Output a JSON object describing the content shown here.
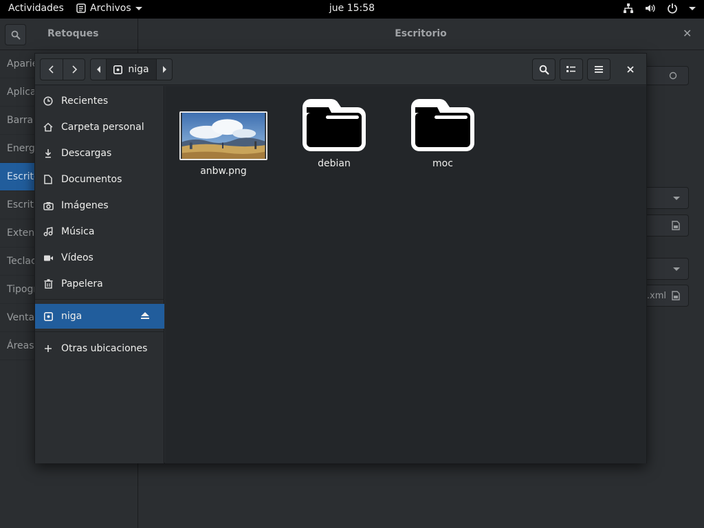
{
  "topbar": {
    "activities": "Actividades",
    "app_name": "Archivos",
    "clock": "jue 15:58"
  },
  "tweaks": {
    "left_title": "Retoques",
    "center_title": "Escritorio",
    "sidebar": [
      "Aparie",
      "Aplica",
      "Barra s",
      "Energí",
      "Escrito",
      "Escritu",
      "Extens",
      "Teclac",
      "Tipogr",
      "Ventan",
      "Áreas"
    ],
    "selected_index": 4,
    "field_suffix": ".xml"
  },
  "dialog": {
    "path_label": "niga",
    "places": [
      {
        "label": "Recientes",
        "icon": "clock-icon"
      },
      {
        "label": "Carpeta personal",
        "icon": "home-icon"
      },
      {
        "label": "Descargas",
        "icon": "download-icon"
      },
      {
        "label": "Documentos",
        "icon": "document-icon"
      },
      {
        "label": "Imágenes",
        "icon": "camera-icon"
      },
      {
        "label": "Música",
        "icon": "music-icon"
      },
      {
        "label": "Vídeos",
        "icon": "video-icon"
      },
      {
        "label": "Papelera",
        "icon": "trash-icon"
      }
    ],
    "mounted": {
      "label": "niga",
      "icon": "drive-icon"
    },
    "other": {
      "label": "Otras ubicaciones",
      "icon": "plus-icon"
    },
    "files": [
      {
        "name": "anbw.png",
        "kind": "image"
      },
      {
        "name": "debian",
        "kind": "folder"
      },
      {
        "name": "moc",
        "kind": "folder"
      }
    ]
  }
}
